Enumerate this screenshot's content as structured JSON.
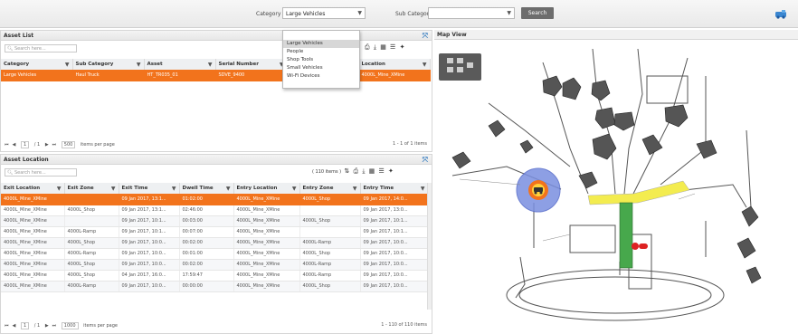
{
  "topbar": {
    "category_label": "Category",
    "category_value": "Large Vehicles",
    "subcategory_label": "Sub Category",
    "subcategory_value": "",
    "search_label": "Search"
  },
  "category_dropdown": [
    "Large Vehicles",
    "People",
    "Shop Tools",
    "Small Vehicles",
    "Wi-Fi Devices"
  ],
  "asset_list": {
    "title": "Asset List",
    "search_placeholder": "Search here...",
    "columns": [
      "Category",
      "Sub Category",
      "Asset",
      "Serial Number",
      "Location"
    ],
    "rows": [
      [
        "Large Vehicles",
        "Haul Truck",
        "HT_TR035_01",
        "SDVE_9400",
        "4000L_Mine_XMine"
      ]
    ],
    "pager_page": "1",
    "pager_of": "/ 1",
    "pager_size": "500",
    "pager_suffix": "items per page",
    "items_info": "1 - 1 of 1 items"
  },
  "asset_location": {
    "title": "Asset Location",
    "search_placeholder": "Search here...",
    "count_badge": "( 110 items )",
    "columns": [
      "Exit Location",
      "Exit Zone",
      "Exit Time",
      "Dwell Time",
      "Entry Location",
      "Entry Zone",
      "Entry Time"
    ],
    "rows": [
      [
        "4000L_Mine_XMine",
        "",
        "09 Jan 2017, 13:1...",
        "01:02:00",
        "4000L_Mine_XMine",
        "4000L_Shop",
        "09 Jan 2017, 14:0..."
      ],
      [
        "4000L_Mine_XMine",
        "4000L_Shop",
        "09 Jan 2017, 13:1...",
        "02:46:00",
        "4000L_Mine_XMine",
        "",
        "09 Jan 2017, 13:0..."
      ],
      [
        "4000L_Mine_XMine",
        "",
        "09 Jan 2017, 10:1...",
        "00:03:00",
        "4000L_Mine_XMine",
        "4000L_Shop",
        "09 Jan 2017, 10:1..."
      ],
      [
        "4000L_Mine_XMine",
        "4000L-Ramp",
        "09 Jan 2017, 10:1...",
        "00:07:00",
        "4000L_Mine_XMine",
        "",
        "09 Jan 2017, 10:1..."
      ],
      [
        "4000L_Mine_XMine",
        "4000L_Shop",
        "09 Jan 2017, 10:0...",
        "00:02:00",
        "4000L_Mine_XMine",
        "4000L-Ramp",
        "09 Jan 2017, 10:0..."
      ],
      [
        "4000L_Mine_XMine",
        "4000L-Ramp",
        "09 Jan 2017, 10:0...",
        "00:01:00",
        "4000L_Mine_XMine",
        "4000L_Shop",
        "09 Jan 2017, 10:0..."
      ],
      [
        "4000L_Mine_XMine",
        "4000L_Shop",
        "09 Jan 2017, 10:0...",
        "00:02:00",
        "4000L_Mine_XMine",
        "4000L-Ramp",
        "09 Jan 2017, 10:0..."
      ],
      [
        "4000L_Mine_XMine",
        "4000L_Shop",
        "04 Jan 2017, 16:0...",
        "17:59:47",
        "4000L_Mine_XMine",
        "4000L-Ramp",
        "09 Jan 2017, 10:0..."
      ],
      [
        "4000L_Mine_XMine",
        "4000L-Ramp",
        "09 Jan 2017, 10:0...",
        "00:00:00",
        "4000L_Mine_XMine",
        "4000L_Shop",
        "09 Jan 2017, 10:0..."
      ]
    ],
    "pager_page": "1",
    "pager_of": "/ 1",
    "pager_size": "1000",
    "pager_suffix": "items per page",
    "items_info": "1 - 110 of 110 items"
  },
  "map": {
    "title": "Map View"
  },
  "colors": {
    "accent": "#f2731c",
    "highlight_road": "#f3ec4f",
    "zone_green": "#47a84c",
    "marker": "#7a8fe0"
  }
}
